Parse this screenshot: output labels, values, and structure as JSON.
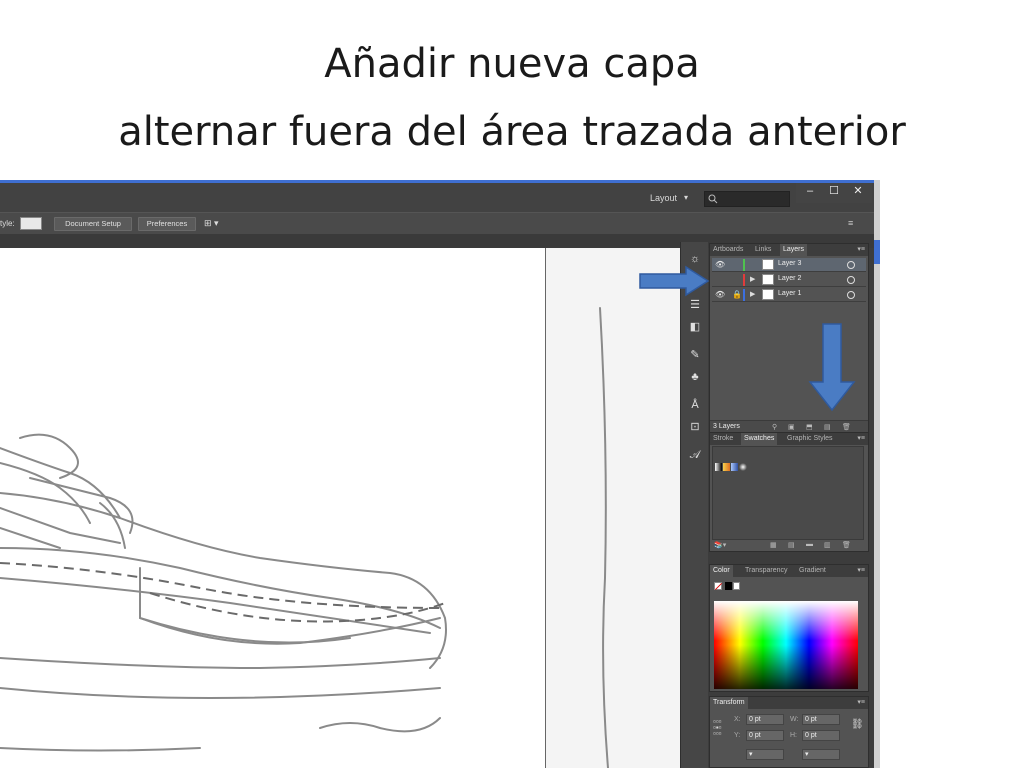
{
  "slide": {
    "title_line1": "Añadir nueva capa",
    "title_line2": "alternar fuera del área trazada anterior"
  },
  "app": {
    "workspace_label": "Layout",
    "control_bar": {
      "style_label": "tyle:",
      "document_setup": "Document Setup",
      "preferences": "Preferences"
    },
    "window_buttons": [
      "–",
      "☐",
      "✕"
    ]
  },
  "layers_panel": {
    "tabs": [
      "Artboards",
      "Links",
      "Layers"
    ],
    "active_tab": "Layers",
    "layers": [
      {
        "name": "Layer 3",
        "visible": true,
        "locked": false,
        "color": "#4fc24f",
        "selected": true
      },
      {
        "name": "Layer 2",
        "visible": false,
        "locked": false,
        "color": "#e03c3c",
        "selected": false
      },
      {
        "name": "Layer 1",
        "visible": true,
        "locked": true,
        "color": "#3c6fe0",
        "selected": false
      }
    ],
    "count_label": "3 Layers"
  },
  "swatches_panel": {
    "tabs": [
      "Stroke",
      "Swatches",
      "Graphic Styles"
    ],
    "active_tab": "Swatches"
  },
  "color_panel": {
    "tabs": [
      "Color",
      "Transparency",
      "Gradient"
    ],
    "active_tab": "Color"
  },
  "transform_panel": {
    "tab": "Transform",
    "x_label": "X:",
    "x_value": "0 pt",
    "y_label": "Y:",
    "y_value": "0 pt",
    "w_label": "W:",
    "w_value": "0 pt",
    "h_label": "H:",
    "h_value": "0 pt"
  },
  "colors": {
    "accent_blue": "#3f6fd1",
    "annotation_arrow": "#4a7cc4"
  }
}
